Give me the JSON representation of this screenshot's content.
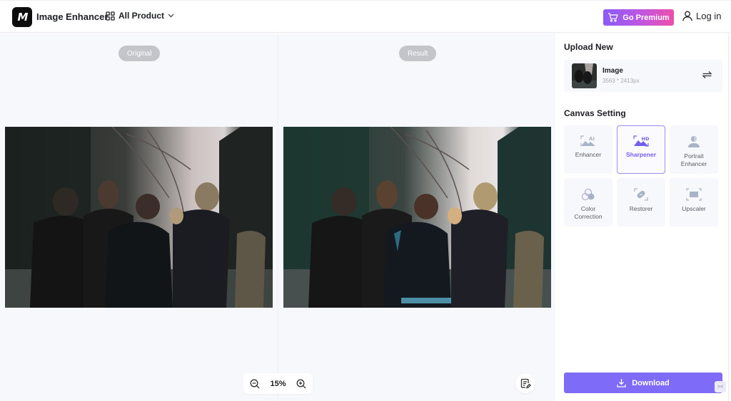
{
  "header": {
    "logo_text": "M",
    "app_title": "Image Enhancer",
    "products_label": "All Product",
    "premium_label": "Go Premium",
    "login_label": "Log in"
  },
  "canvas": {
    "original_label": "Original",
    "result_label": "Result",
    "zoom_level": "15%"
  },
  "panel": {
    "upload_title": "Upload New",
    "image": {
      "name": "Image",
      "dimensions": "3563 * 2413px"
    },
    "canvas_title": "Canvas Setting",
    "tools": [
      {
        "id": "enhancer",
        "label": "Enhancer",
        "icon": "ai-image-icon",
        "active": false
      },
      {
        "id": "sharpener",
        "label": "Sharpener",
        "icon": "hd-image-icon",
        "active": true
      },
      {
        "id": "portrait",
        "label": "Portrait Enhancer",
        "icon": "portrait-icon",
        "active": false
      },
      {
        "id": "color",
        "label": "Color Correction",
        "icon": "color-circles-icon",
        "active": false
      },
      {
        "id": "restorer",
        "label": "Restorer",
        "icon": "bandage-icon",
        "active": false
      },
      {
        "id": "upscaler",
        "label": "Upscaler",
        "icon": "expand-icon",
        "active": false
      }
    ],
    "download_label": "Download"
  },
  "colors": {
    "accent": "#7e6cf8",
    "premium_gradient_start": "#8a5cf6",
    "premium_gradient_end": "#ee4fa9",
    "canvas_bg": "#f7f8fc",
    "active_border": "#9c8cf5"
  }
}
